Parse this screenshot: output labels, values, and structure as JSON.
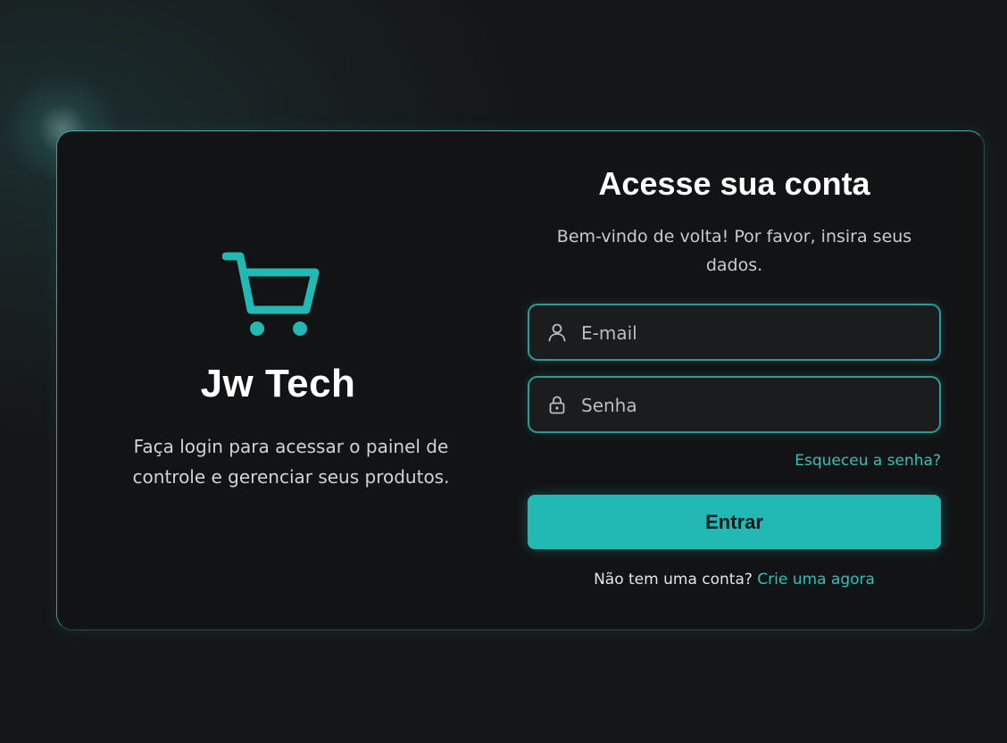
{
  "colors": {
    "accent": "#22b8b4",
    "background": "#151617",
    "card": "#121314",
    "link": "#2fc1bb"
  },
  "brand": {
    "icon": "shopping-cart-icon",
    "name": "Jw Tech",
    "tagline": "Faça login para acessar o painel de controle e gerenciar seus produtos."
  },
  "login": {
    "title": "Acesse sua conta",
    "subtitle": "Bem-vindo de volta! Por favor, insira seus dados.",
    "email": {
      "icon": "user-icon",
      "placeholder": "E-mail",
      "value": ""
    },
    "password": {
      "icon": "lock-icon",
      "placeholder": "Senha",
      "value": ""
    },
    "forgot_label": "Esqueceu a senha?",
    "submit_label": "Entrar",
    "signup_prompt": "Não tem uma conta?",
    "signup_link": "Crie uma agora"
  }
}
